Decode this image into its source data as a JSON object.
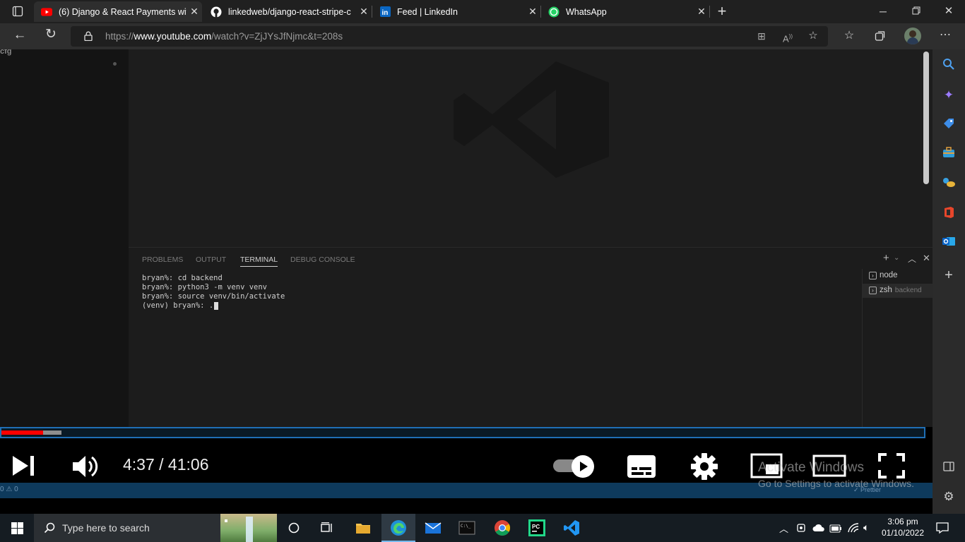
{
  "tabs": [
    {
      "title": "(6) Django & React Payments wit",
      "favicon": "youtube-icon",
      "active": true
    },
    {
      "title": "linkedweb/django-react-stripe-c",
      "favicon": "github-icon",
      "active": false
    },
    {
      "title": "Feed | LinkedIn",
      "favicon": "linkedin-icon",
      "active": false
    },
    {
      "title": "WhatsApp",
      "favicon": "whatsapp-icon",
      "active": false
    }
  ],
  "address": {
    "prefix": "https://",
    "host": "www.youtube.com",
    "path": "/watch?v=ZjJYsJfNjmc&t=208s"
  },
  "video": {
    "corner_text": "cfg",
    "panel_tabs": [
      "PROBLEMS",
      "OUTPUT",
      "TERMINAL",
      "DEBUG CONSOLE"
    ],
    "active_panel_tab": "TERMINAL",
    "terminal_lines": [
      "bryan%: cd backend",
      "bryan%: python3 -m venv venv",
      "bryan%: source venv/bin/activate",
      "(venv) bryan%: ."
    ],
    "terminal_list": [
      {
        "name": "node",
        "detail": ""
      },
      {
        "name": "zsh",
        "detail": "backend"
      }
    ],
    "status_left": "0 ⚠ 0",
    "status_right": "✓ Prettier"
  },
  "player": {
    "time": "4:37 / 41:06",
    "progress_fraction": 0.045,
    "buffer_fraction": 0.065,
    "autoplay_on": true
  },
  "watermark": {
    "line1": "Activate Windows",
    "line2": "Go to Settings to activate Windows."
  },
  "taskbar": {
    "search_placeholder": "Type here to search",
    "time": "3:06 pm",
    "date": "01/10/2022"
  },
  "colors": {
    "progress": "#ff0000",
    "accent": "#0078d4",
    "vscode_status": "#0e3a5c"
  }
}
